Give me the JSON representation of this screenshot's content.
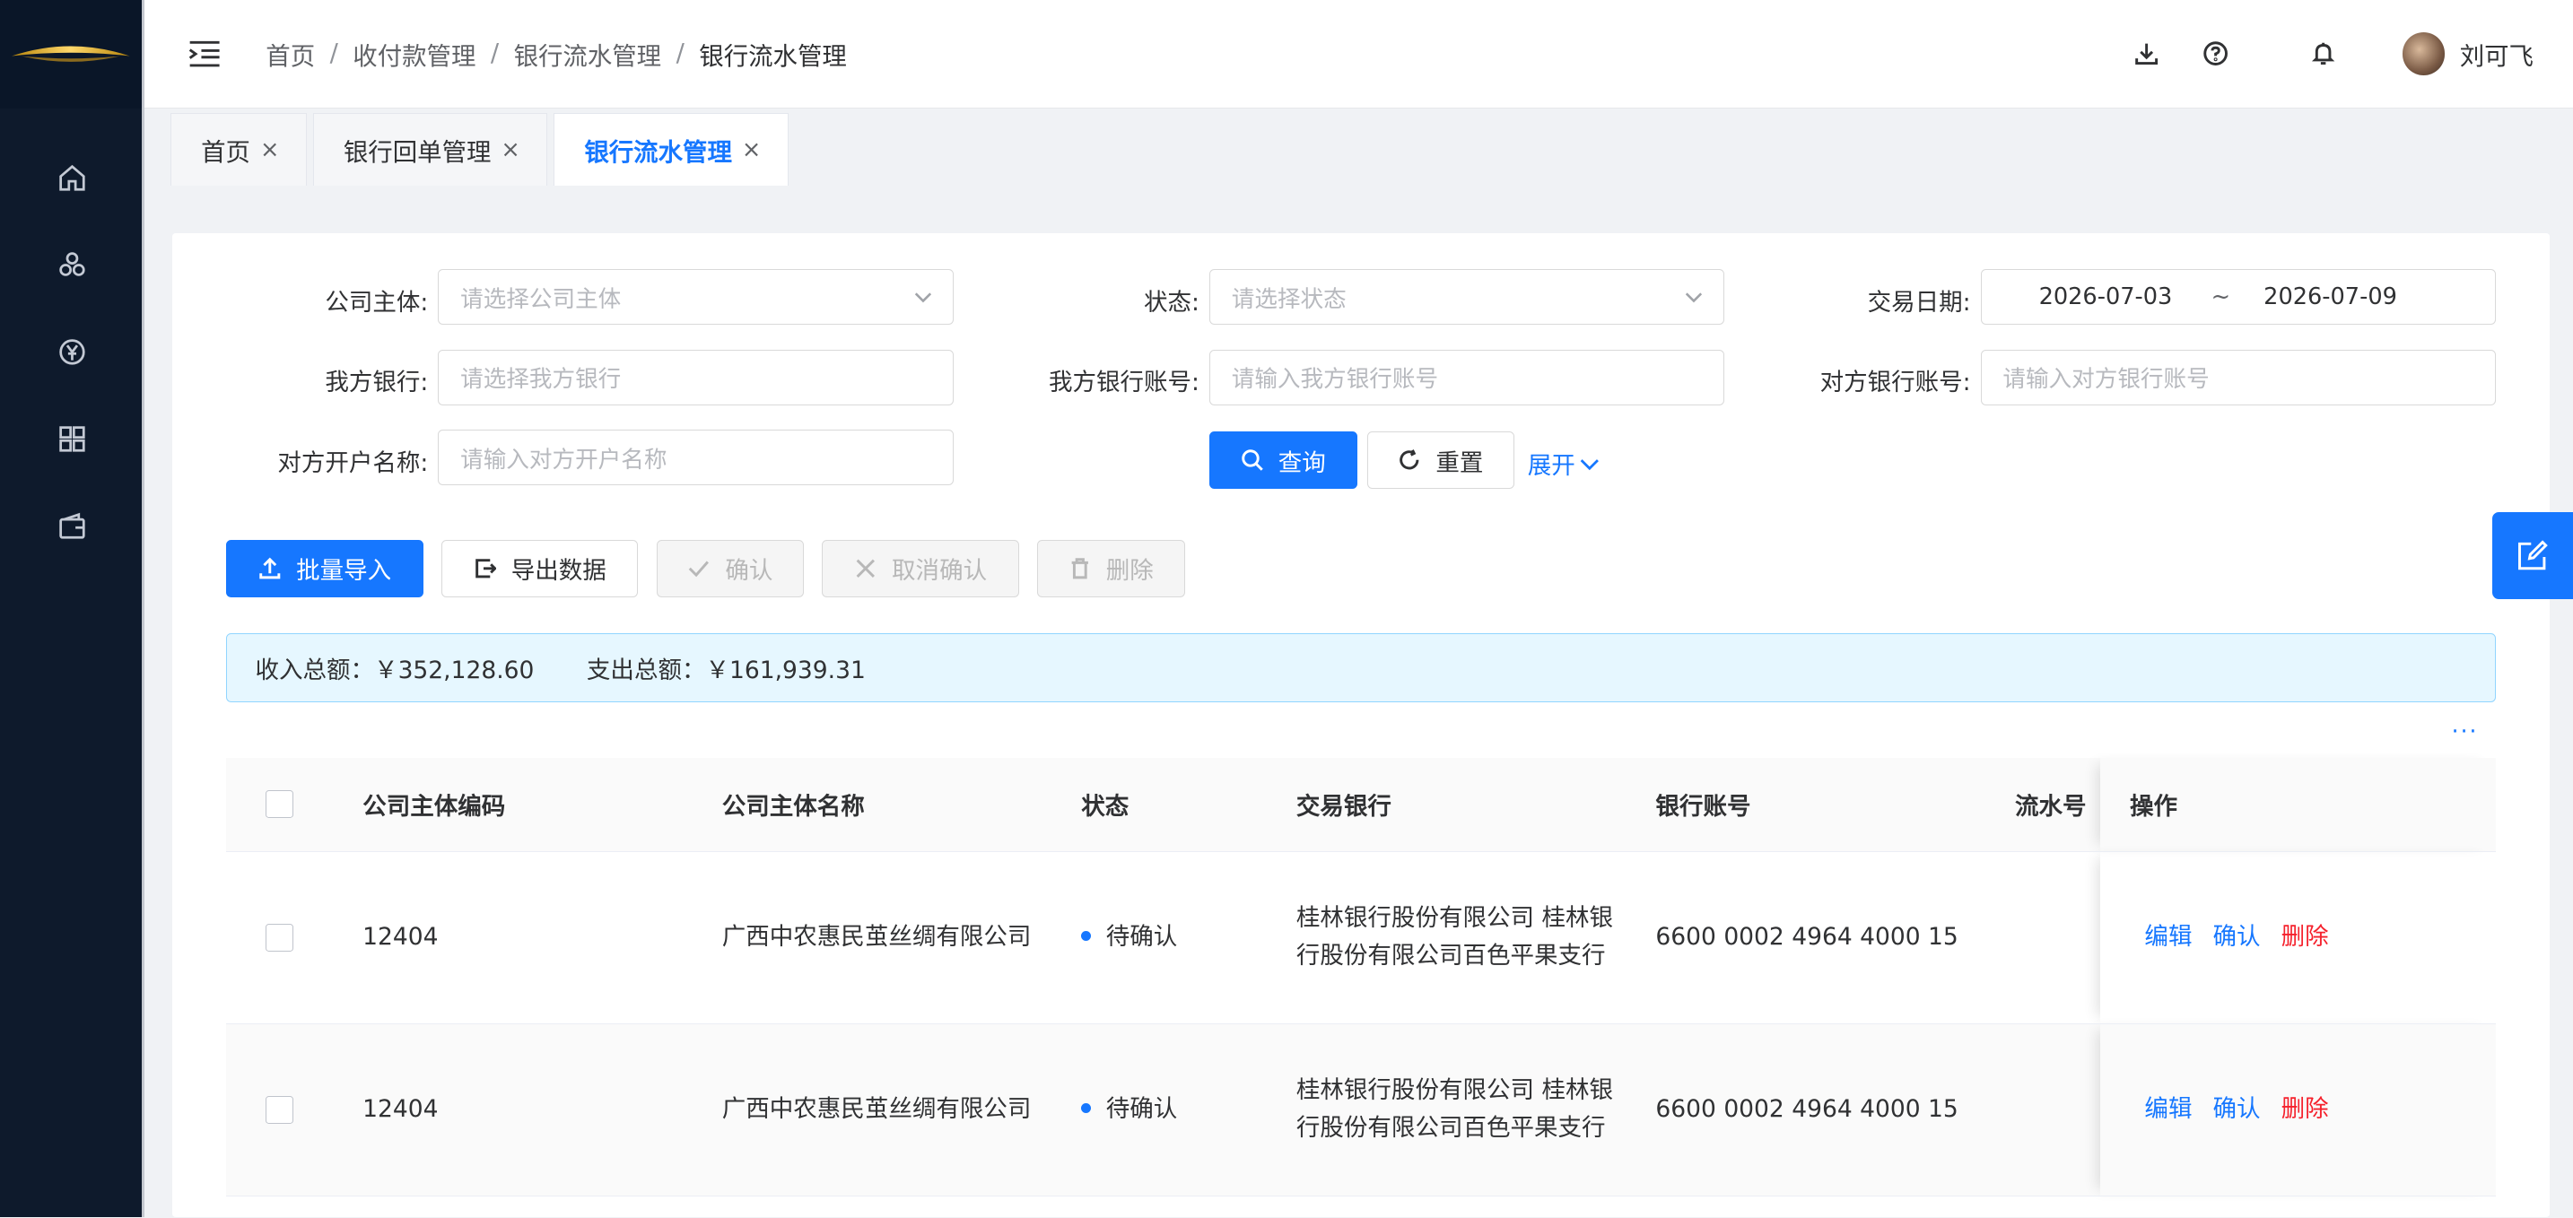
{
  "header": {
    "breadcrumb": [
      "首页",
      "收付款管理",
      "银行流水管理",
      "银行流水管理"
    ],
    "breadcrumb_sep": "/",
    "user_name": "刘可飞"
  },
  "sidebar": {
    "icons": [
      "home-icon",
      "cluster-icon",
      "currency-icon",
      "apps-icon",
      "wallet-icon"
    ]
  },
  "tabs": [
    {
      "label": "首页",
      "close": "×",
      "active": false
    },
    {
      "label": "银行回单管理",
      "close": "×",
      "active": false
    },
    {
      "label": "银行流水管理",
      "close": "×",
      "active": true
    }
  ],
  "filters": {
    "company_label": "公司主体:",
    "company_placeholder": "请选择公司主体",
    "status_label": "状态:",
    "status_placeholder": "请选择状态",
    "date_label": "交易日期:",
    "date_start": "2026-07-03",
    "date_sep": "~",
    "date_end": "2026-07-09",
    "our_bank_label": "我方银行:",
    "our_bank_placeholder": "请选择我方银行",
    "our_account_label": "我方银行账号:",
    "our_account_placeholder": "请输入我方银行账号",
    "their_account_label": "对方银行账号:",
    "their_account_placeholder": "请输入对方银行账号",
    "their_name_label": "对方开户名称:",
    "their_name_placeholder": "请输入对方开户名称",
    "search_label": "查询",
    "reset_label": "重置",
    "expand_label": "展开"
  },
  "actions": {
    "import_label": "批量导入",
    "export_label": "导出数据",
    "confirm_label": "确认",
    "cancel_confirm_label": "取消确认",
    "delete_label": "删除"
  },
  "summary": {
    "income_label": "收入总额：",
    "income_value": "￥352,128.60",
    "expense_label": "支出总额：",
    "expense_value": "￥161,939.31"
  },
  "more_dots": "···",
  "table": {
    "columns": [
      "公司主体编码",
      "公司主体名称",
      "状态",
      "交易银行",
      "银行账号",
      "流水号",
      "操作"
    ],
    "rows": [
      {
        "code": "12404",
        "name": "广西中农惠民茧丝绸有限公司",
        "status": "待确认",
        "bank": "桂林银行股份有限公司 桂林银行股份有限公司百色平果支行",
        "account": "6600 0002 4964 4000 15",
        "serial": "",
        "op_edit": "编辑",
        "op_confirm": "确认",
        "op_delete": "删除"
      },
      {
        "code": "12404",
        "name": "广西中农惠民茧丝绸有限公司",
        "status": "待确认",
        "bank": "桂林银行股份有限公司 桂林银行股份有限公司百色平果支行",
        "account": "6600 0002 4964 4000 15",
        "serial": "",
        "op_edit": "编辑",
        "op_confirm": "确认",
        "op_delete": "删除"
      }
    ]
  },
  "colors": {
    "primary": "#1677ff",
    "danger": "#f5222d",
    "sidebar_bg": "#0e1a2c",
    "summary_bg": "#e6f7ff"
  }
}
